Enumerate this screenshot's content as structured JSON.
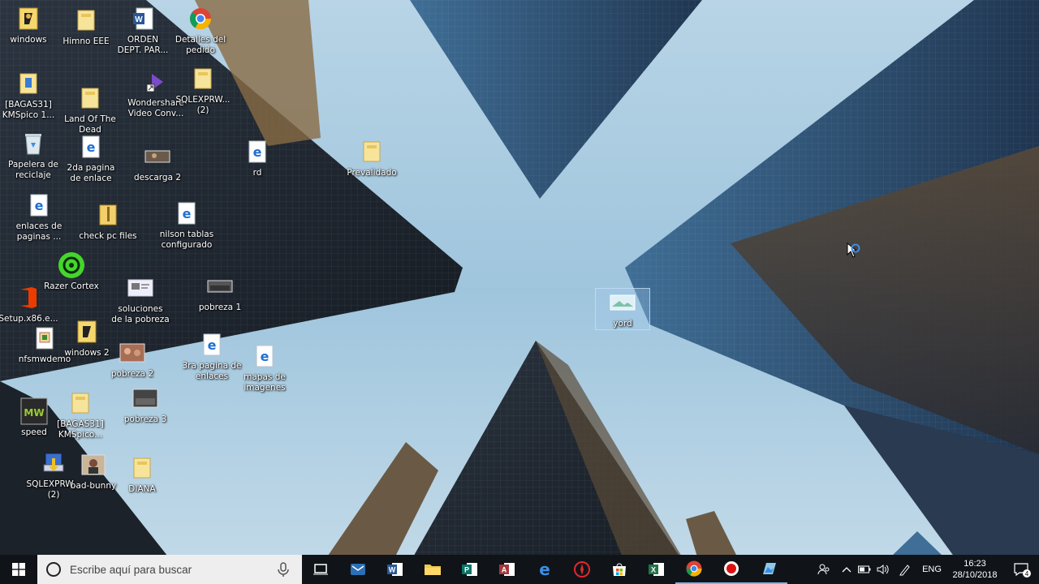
{
  "desktop": {
    "icons": [
      {
        "label": "windows",
        "icon": "windows-shortcut-icon"
      },
      {
        "label": "Himno EEE",
        "icon": "folder-icon"
      },
      {
        "label": "ORDEN\nDEPT. PAR...",
        "icon": "word-document-icon"
      },
      {
        "label": "Detalles del\npedido",
        "icon": "chrome-icon"
      },
      {
        "label": "[BAGAS31]\nKMSpico 1...",
        "icon": "installer-icon"
      },
      {
        "label": "Land Of The\nDead",
        "icon": "folder-icon"
      },
      {
        "label": "Wondershare\nVideo Conv...",
        "icon": "wondershare-icon"
      },
      {
        "label": "SQLEXPRW...\n(2)",
        "icon": "folder-icon"
      },
      {
        "label": "Papelera de\nreciclaje",
        "icon": "recycle-bin-icon"
      },
      {
        "label": "2da pagina\nde enlace",
        "icon": "edge-file-icon"
      },
      {
        "label": "descarga 2",
        "icon": "image-thumbnail-icon"
      },
      {
        "label": "rd",
        "icon": "edge-file-icon"
      },
      {
        "label": "Prevalidado",
        "icon": "folder-icon"
      },
      {
        "label": "enlaces de\npaginas ...",
        "icon": "edge-file-icon"
      },
      {
        "label": "check pc files",
        "icon": "folder-zip-icon"
      },
      {
        "label": "nilson tablas\nconfigurado",
        "icon": "edge-file-icon"
      },
      {
        "label": "Razer Cortex",
        "icon": "razer-cortex-icon"
      },
      {
        "label": "soluciones\nde la pobreza",
        "icon": "image-thumbnail-icon"
      },
      {
        "label": "pobreza 1",
        "icon": "image-thumbnail-icon"
      },
      {
        "label": "Setup.x86.e...",
        "icon": "office-icon"
      },
      {
        "label": "nfsmwdemo",
        "icon": "installer-icon"
      },
      {
        "label": "windows 2",
        "icon": "windows-shortcut-icon"
      },
      {
        "label": "pobreza 2",
        "icon": "image-thumbnail-icon"
      },
      {
        "label": "3ra pagina de\nenlaces",
        "icon": "edge-file-icon"
      },
      {
        "label": "mapas de\nimagenes",
        "icon": "edge-file-icon"
      },
      {
        "label": "speed",
        "icon": "nfs-game-icon"
      },
      {
        "label": "[BAGAS31]\nKMSpico...",
        "icon": "folder-icon"
      },
      {
        "label": "pobreza 3",
        "icon": "image-thumbnail-icon"
      },
      {
        "label": "SQLEXPRW...\n(2)",
        "icon": "setup-icon"
      },
      {
        "label": "bad-bunny",
        "icon": "image-thumbnail-icon"
      },
      {
        "label": "DIANA",
        "icon": "folder-icon"
      },
      {
        "label": "yord",
        "icon": "image-thumbnail-icon",
        "selected": true
      }
    ]
  },
  "taskbar": {
    "search_placeholder": "Escribe aquí para buscar",
    "pinned": [
      {
        "name": "task-view-icon"
      },
      {
        "name": "mail-icon"
      },
      {
        "name": "word-icon"
      },
      {
        "name": "file-explorer-icon"
      },
      {
        "name": "publisher-icon"
      },
      {
        "name": "access-icon"
      },
      {
        "name": "edge-icon"
      },
      {
        "name": "razer-icon"
      },
      {
        "name": "store-icon"
      },
      {
        "name": "excel-icon"
      },
      {
        "name": "chrome-icon"
      },
      {
        "name": "recorder-icon"
      },
      {
        "name": "photo-viewer-icon"
      }
    ],
    "tray": {
      "language": "ENG",
      "time": "16:23",
      "date": "28/10/2018",
      "notification_count": "4"
    }
  },
  "colors": {
    "taskbar": "#101418",
    "sky": "#9cc4dc",
    "edge_blue": "#1f6fd0"
  }
}
